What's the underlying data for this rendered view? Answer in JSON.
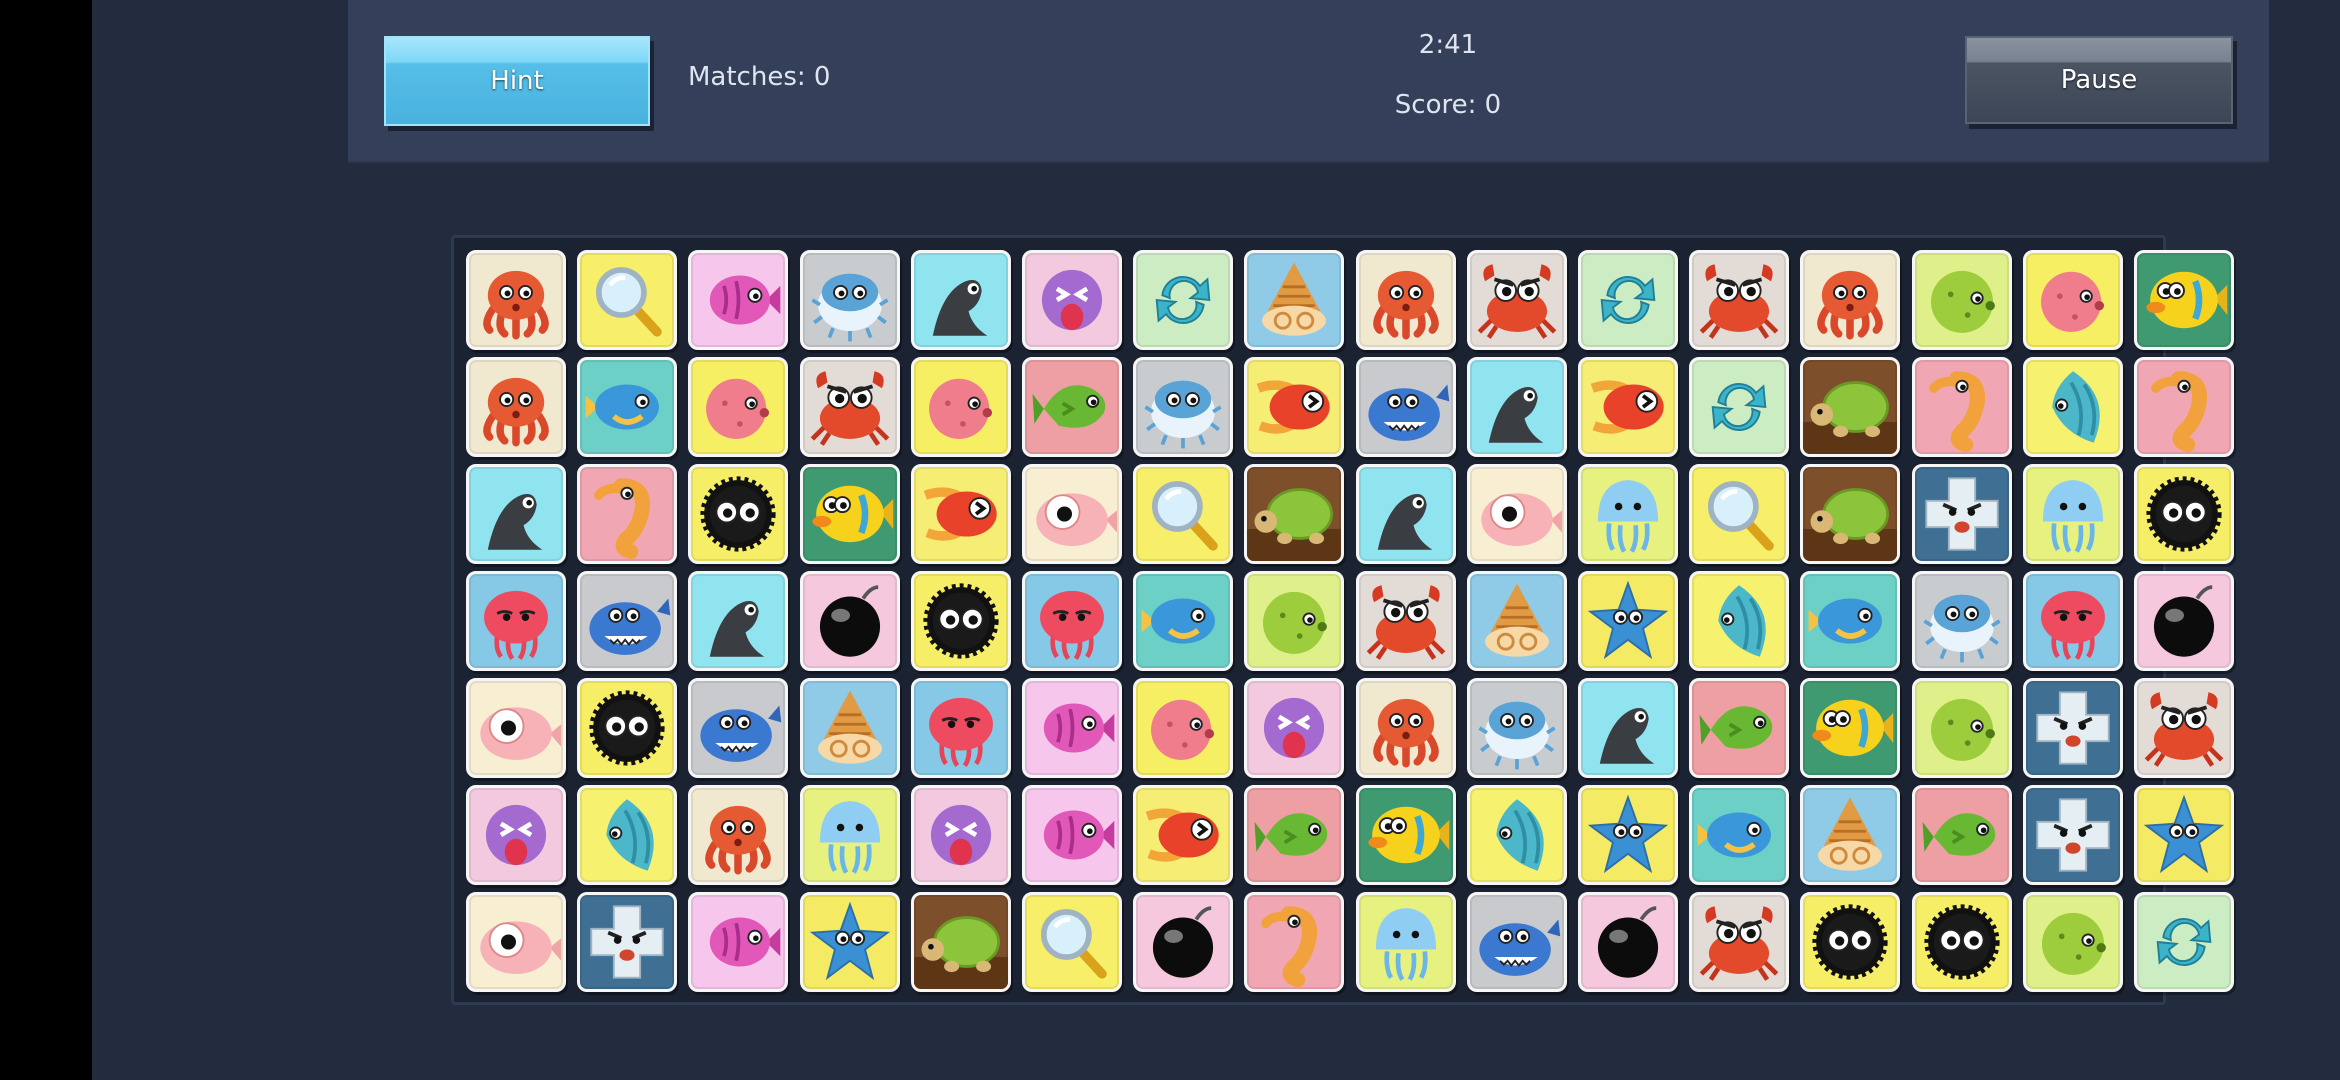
{
  "header": {
    "hint_label": "Hint",
    "matches_text": "Matches: 0",
    "timer": "2:41",
    "score_text": "Score: 0",
    "pause_label": "Pause"
  },
  "colors": {
    "background": "#232c3e",
    "header": "#343f5a",
    "hint_button": "#56bfe8",
    "pause_button": "#4a5463"
  },
  "board": {
    "rows": 7,
    "cols": 16,
    "tiles": [
      [
        "octopus",
        "magnifier",
        "pink-fish",
        "pufferfish",
        "seal",
        "purple-blob",
        "refresh",
        "hermit-snail",
        "octopus",
        "crab",
        "refresh",
        "crab",
        "octopus",
        "green-blowfish",
        "pink-blowfish",
        "yellow-fish"
      ],
      [
        "octopus",
        "blue-fish",
        "pink-blowfish",
        "crab",
        "pink-blowfish",
        "green-fish",
        "pufferfish",
        "red-bird-fish",
        "whale",
        "seal",
        "red-bird-fish",
        "refresh",
        "turtle",
        "seahorse",
        "angelfish",
        "seahorse"
      ],
      [
        "seal",
        "seahorse",
        "sea-urchin",
        "yellow-fish",
        "red-bird-fish",
        "pink-eyeball",
        "magnifier",
        "turtle",
        "seal",
        "pink-eyeball",
        "jellyfish",
        "magnifier",
        "turtle",
        "angry-block",
        "jellyfish",
        "sea-urchin"
      ],
      [
        "red-jelly",
        "whale",
        "seal",
        "bomb",
        "sea-urchin",
        "red-jelly",
        "blue-fish",
        "green-blowfish",
        "crab",
        "hermit-snail",
        "starfish",
        "angelfish",
        "blue-fish",
        "pufferfish",
        "red-jelly",
        "bomb"
      ],
      [
        "pink-eyeball",
        "sea-urchin",
        "whale",
        "hermit-snail",
        "red-jelly",
        "pink-fish",
        "pink-blowfish",
        "purple-blob",
        "octopus",
        "pufferfish",
        "seal",
        "green-fish",
        "yellow-fish",
        "green-blowfish",
        "angry-block",
        "crab"
      ],
      [
        "purple-blob",
        "angelfish",
        "octopus",
        "jellyfish",
        "purple-blob",
        "pink-fish",
        "red-bird-fish",
        "green-fish",
        "yellow-fish",
        "angelfish",
        "starfish",
        "blue-fish",
        "hermit-snail",
        "green-fish",
        "angry-block",
        "starfish"
      ],
      [
        "pink-eyeball",
        "angry-block",
        "pink-fish",
        "starfish",
        "turtle",
        "magnifier",
        "bomb",
        "seahorse",
        "jellyfish",
        "whale",
        "bomb",
        "crab",
        "sea-urchin",
        "sea-urchin",
        "green-blowfish",
        "refresh"
      ]
    ]
  }
}
